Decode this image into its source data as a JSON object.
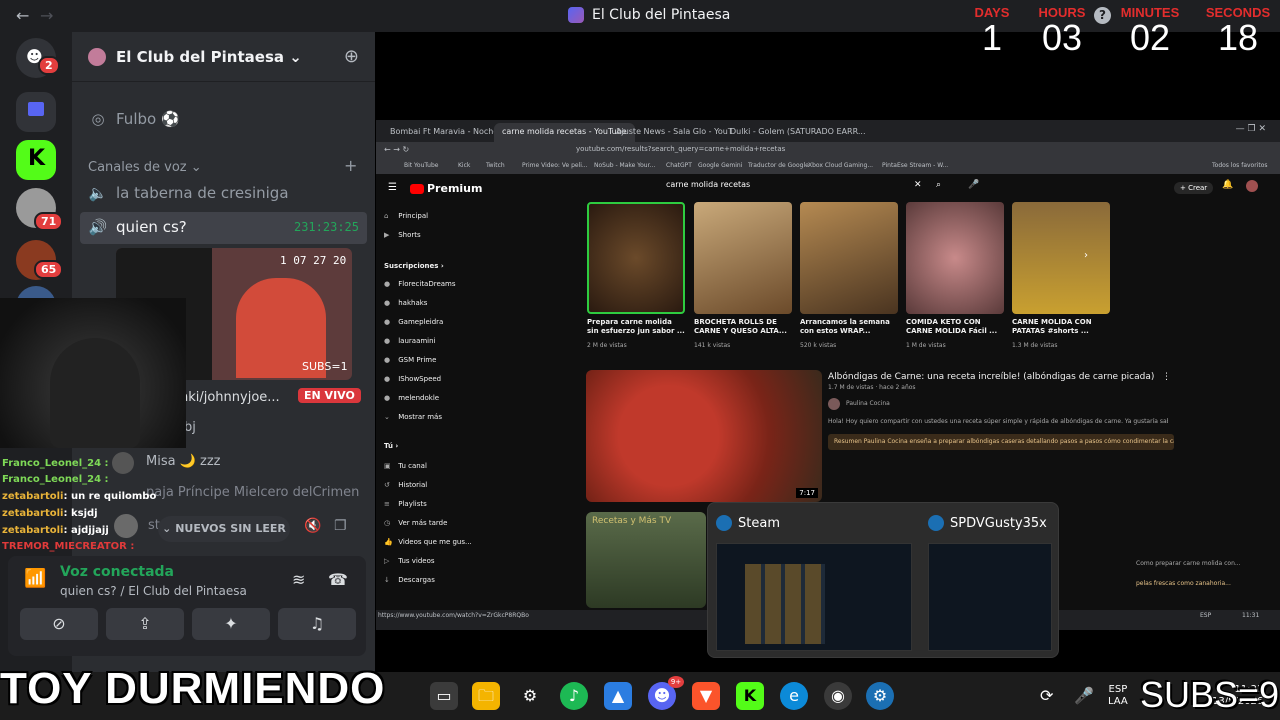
{
  "window": {
    "title": "El Club del Pintaesa"
  },
  "countdown": {
    "days_label": "DAYS",
    "days": "1",
    "hours_label": "HOURS",
    "hours": "03",
    "minutes_label": "MINUTES",
    "minutes": "02",
    "seconds_label": "SECONDS",
    "seconds": "18"
  },
  "rail": {
    "dm_badge": "2",
    "srv_badge_1": "71",
    "srv_badge_2": "65"
  },
  "server": {
    "name": "El Club del Pintaesa",
    "fulbo": "Fulbo",
    "voice_category": "Canales de voz",
    "channel_1": "la taberna de cresiniga",
    "channel_2": "quien cs?",
    "channel_2_time": "231:23:25",
    "stream_timer": "1  07  27  20",
    "stream_subs": "SUBS=1",
    "streamer": "anki/johnnyjoe...",
    "live": "EN VIVO",
    "member_partial": "bj",
    "misa": "Misa",
    "misa_status": "zzz",
    "paja": "paja Príncipe Mielcero delCrimen",
    "unread": "NUEVOS SIN LEER"
  },
  "chat": [
    {
      "user": "Franco_Leonel_24 :",
      "msg": ""
    },
    {
      "user": "Franco_Leonel_24 :",
      "msg": ""
    },
    {
      "user": "zetabartoli",
      "msg": ": un re quilombo"
    },
    {
      "user": "zetabartoli",
      "msg": ": ksjdj"
    },
    {
      "user": "zetabartoli",
      "msg": ": ajdjjajj"
    },
    {
      "user": "TREMOR_MIECREATOR :",
      "msg": ""
    }
  ],
  "voice": {
    "status": "Voz conectada",
    "location": "quien cs? / El Club del Pintaesa"
  },
  "browser": {
    "tabs": [
      "Bombai Ft Maravia - Noche Loca",
      "carne molida recetas - YouTube",
      "Ajuste News - Sala Glo - YouT",
      "Dulki - Golem (SATURADO EARR..."
    ],
    "url": "youtube.com/results?search_query=carne+molida+recetas",
    "bookmarks": [
      "Bit YouTube",
      "Kick",
      "Twitch",
      "Prime Video: Ve peli...",
      "NoSub - Make Your...",
      "ChatGPT",
      "Google Gemini",
      "Traductor de Google",
      "Xbox Cloud Gaming...",
      "PintaEse Stream - W..."
    ],
    "all_bookmarks": "Todos los favoritos",
    "premium": "Premium",
    "search": "carne molida recetas",
    "create": "+ Crear",
    "sidebar_main": [
      "Principal",
      "Shorts"
    ],
    "subs_label": "Suscripciones",
    "subs": [
      "FlorecitaDreams",
      "hakhaks",
      "Gamepleidra",
      "lauraamini",
      "GSM Prime",
      "IShowSpeed",
      "melendokle",
      "Mostrar más"
    ],
    "you_label": "Tú",
    "you_items": [
      "Tu canal",
      "Historial",
      "Playlists",
      "Ver más tarde",
      "Videos que me gus...",
      "Tus videos",
      "Descargas"
    ],
    "videos": [
      {
        "title": "Prepara carne molida sin esfuerzo jun sabor ...",
        "meta": "2 M de vistas"
      },
      {
        "title": "BROCHETA ROLLS DE CARNE Y QUESO ALTA...",
        "meta": "141 k vistas"
      },
      {
        "title": "Arrancamos la semana con estos WRAP...",
        "meta": "520 k vistas"
      },
      {
        "title": "COMIDA KETO CON CARNE MOLIDA Fácil ...",
        "meta": "1 M de vistas"
      },
      {
        "title": "CARNE MOLIDA CON PATATAS #shorts ...",
        "meta": "1.3 M de vistas"
      }
    ],
    "featured_title": "Albóndigas de Carne: una receta increíble! (albóndigas de carne picada)",
    "featured_meta": "1.7 M de vistas · hace 2 años",
    "featured_author": "Paulina Cocina",
    "featured_desc": "Hola! Hoy quiero compartir con ustedes una receta súper simple y rápida de albóndigas de carne. Ya gustaría saber cómo hacer...",
    "resumen": "Resumen  Paulina Cocina enseña a preparar albóndigas caseras detallando pasos a pasos cómo condimentar la carne y...",
    "featured_duration": "7:17",
    "second_thumb_text": "Recetas y Más TV",
    "status_url": "https://www.youtube.com/watch?v=ZrGkcP8RQBo",
    "second_desc": "Como preparar carne molida con...",
    "second_desc2": "pelas frescas como zanahoria..."
  },
  "popup": {
    "left": "Steam",
    "right": "SPDVGusty35x"
  },
  "taskbar": {
    "discord_badge": "9+",
    "lang": "ESP",
    "lang_sub": "LAA",
    "time": "11:31",
    "date": "13/8/2026"
  },
  "overlay": {
    "left_text": "TOY DURMIENDO",
    "right_text": "SUBS=9"
  },
  "colors": {
    "discord_bg": "#2b2d31",
    "voice_green": "#23a55a",
    "live_red": "#da373c",
    "countdown_red": "#e32d2d"
  }
}
